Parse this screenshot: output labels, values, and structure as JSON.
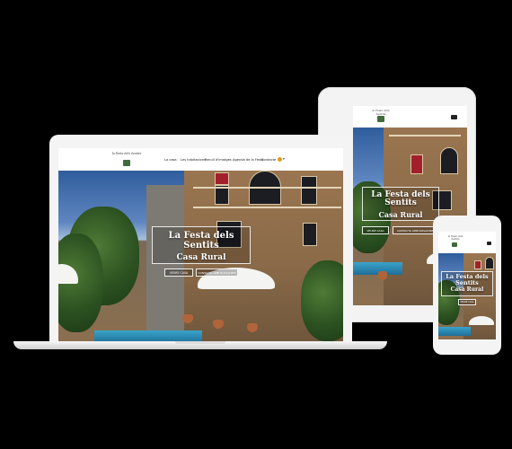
{
  "brand": {
    "logo_text": "la Festa dels Sentits"
  },
  "nav": {
    "items": [
      "La casa",
      "Les habitacions",
      "Recull d'imatges",
      "Agenda de la Festa",
      "Contacte"
    ],
    "lang_arrow": "▾"
  },
  "hero": {
    "title": "La Festa dels Sentits",
    "subtitle": "Casa Rural",
    "btn_primary": "VEURE CASA",
    "btn_secondary": "CONTACTA AMB NOSALTRES"
  },
  "colors": {
    "background": "#000000",
    "sky": "#2f5d9c",
    "wall": "#9a7550",
    "flag": "#e39b1b"
  }
}
